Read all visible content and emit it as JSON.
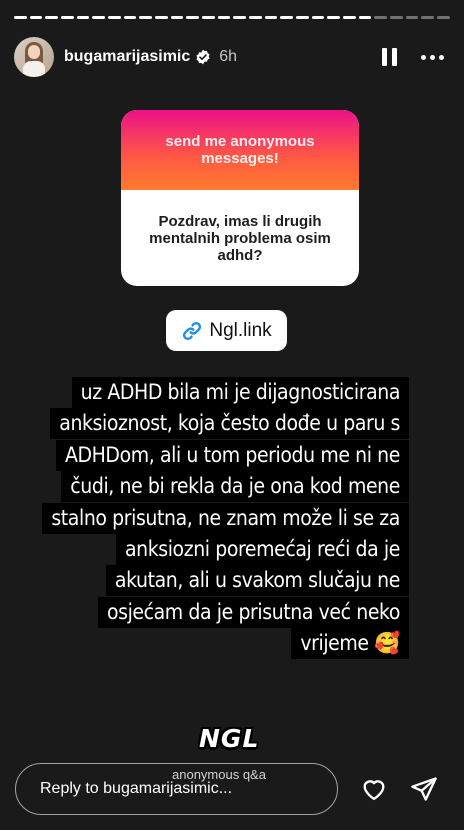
{
  "story": {
    "segments": [
      true,
      true,
      true,
      true,
      true,
      true,
      true,
      true,
      true,
      true,
      true,
      true,
      true,
      true,
      true,
      true,
      true,
      true,
      true,
      true,
      true,
      true,
      true,
      false,
      false,
      false,
      false,
      false
    ]
  },
  "header": {
    "username": "bugamarijasimic",
    "time": "6h",
    "verified_icon": "verified-badge-icon",
    "pause_icon": "pause-icon",
    "more_icon": "more-options-icon"
  },
  "question_card": {
    "prompt": "send me anonymous messages!",
    "question": "Pozdrav, imas li drugih mentalnih problema osim adhd?"
  },
  "link_sticker": {
    "label": "Ngl.link",
    "icon": "link-icon",
    "accent": "#1d8dee"
  },
  "answer_lines": [
    "uz ADHD bila mi je dijagnosticirana",
    "anksioznost, koja često dođe u paru s",
    "ADHDom, ali u tom periodu me ni ne",
    "čudi, ne bi rekla da  je ona kod mene",
    "stalno prisutna, ne znam može li se za",
    "anksiozni poremećaj reći da je",
    "akutan, ali u svakom slučaju ne",
    "osjećam da je prisutna već neko",
    "vrijeme 🥰"
  ],
  "sticker": {
    "text": "NGL"
  },
  "footer": {
    "caption": "anonymous q&a",
    "reply_placeholder": "Reply to bugamarijasimic...",
    "heart_icon": "heart-icon",
    "send_icon": "send-icon"
  },
  "colors": {
    "background": "#1a1a1a",
    "card_gradient_start": "#ec1187",
    "card_gradient_end": "#ff7a2e"
  }
}
